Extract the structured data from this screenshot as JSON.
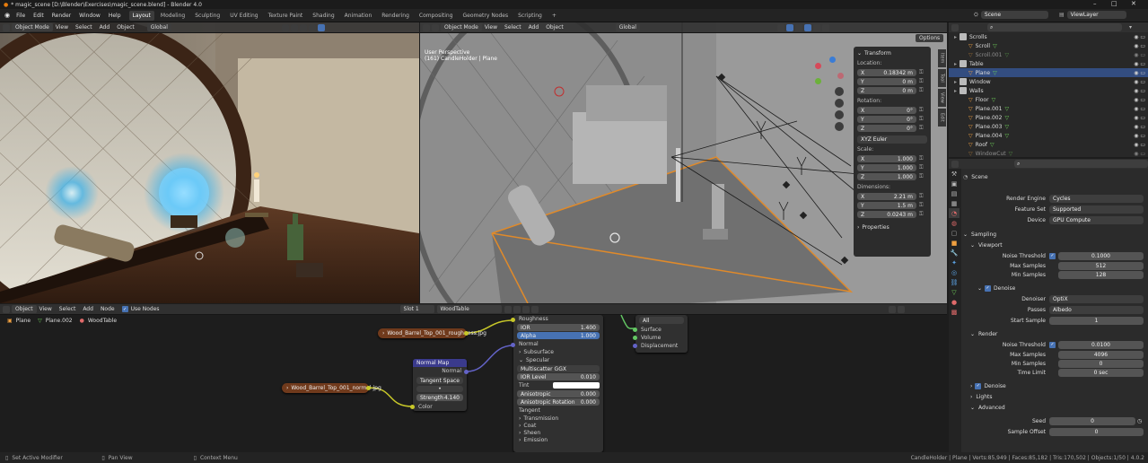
{
  "window": {
    "title": "* magic_scene [D:\\Blender\\Exercises\\magic_scene.blend] - Blender 4.0",
    "min": "–",
    "max": "□",
    "close": "✕"
  },
  "menu": [
    "File",
    "Edit",
    "Render",
    "Window",
    "Help"
  ],
  "workspaces": [
    "Layout",
    "Modeling",
    "Sculpting",
    "UV Editing",
    "Texture Paint",
    "Shading",
    "Animation",
    "Rendering",
    "Compositing",
    "Geometry Nodes",
    "Scripting"
  ],
  "active_workspace": "Layout",
  "add_workspace": "+",
  "scene": "Scene",
  "view_layer": "ViewLayer",
  "vp1": {
    "mode": "Object Mode",
    "menus": [
      "View",
      "Select",
      "Add",
      "Object"
    ],
    "orientation": "Global"
  },
  "vp2": {
    "mode": "Object Mode",
    "menus": [
      "View",
      "Select",
      "Add",
      "Object"
    ],
    "orientation": "Global",
    "options": "Options",
    "overlay_line1": "User Perspective",
    "overlay_line2": "(161) CandleHolder | Plane",
    "tabs": [
      "Item",
      "Tool",
      "View",
      "Edit"
    ],
    "transform": {
      "title": "Transform",
      "location_label": "Location:",
      "location": [
        {
          "axis": "X",
          "value": "0.18342 m"
        },
        {
          "axis": "Y",
          "value": "0 m"
        },
        {
          "axis": "Z",
          "value": "0 m"
        }
      ],
      "rotation_label": "Rotation:",
      "rotation": [
        {
          "axis": "X",
          "value": "0°"
        },
        {
          "axis": "Y",
          "value": "0°"
        },
        {
          "axis": "Z",
          "value": "0°"
        }
      ],
      "rotation_mode": "XYZ Euler",
      "scale_label": "Scale:",
      "scale": [
        {
          "axis": "X",
          "value": "1.000"
        },
        {
          "axis": "Y",
          "value": "1.000"
        },
        {
          "axis": "Z",
          "value": "1.000"
        }
      ],
      "dimensions_label": "Dimensions:",
      "dimensions": [
        {
          "axis": "X",
          "value": "2.21 m"
        },
        {
          "axis": "Y",
          "value": "1.5 m"
        },
        {
          "axis": "Z",
          "value": "0.0243 m"
        }
      ],
      "properties": "Properties"
    }
  },
  "node_editor": {
    "editor_type": "Object",
    "menus": [
      "View",
      "Select",
      "Add",
      "Node"
    ],
    "use_nodes": "Use Nodes",
    "slot": "Slot 1",
    "material": "WoodTable",
    "breadcrumb": [
      "Plane",
      "Plane.002",
      "WoodTable"
    ],
    "img_roughness": "Wood_Barrel_Top_001_roughness.jpg",
    "img_normal": "Wood_Barrel_Top_001_normal.jpg",
    "normal_map": {
      "title": "Normal Map",
      "output": "Normal",
      "space": "Tangent Space",
      "strength_label": "Strength",
      "strength": "4.140",
      "color": "Color"
    },
    "bsdf": {
      "roughness": "Roughness",
      "ior_label": "IOR",
      "ior": "1.400",
      "alpha_label": "Alpha",
      "alpha": "1.000",
      "normal": "Normal",
      "subsurface": "Subsurface",
      "specular": "Specular",
      "distribution": "Multiscatter GGX",
      "ior_level_label": "IOR Level",
      "ior_level": "0.010",
      "tint": "Tint",
      "anisotropic_label": "Anisotropic",
      "anisotropic": "0.000",
      "aniso_rot_label": "Anisotropic Rotation",
      "aniso_rot": "0.000",
      "tangent": "Tangent",
      "transmission": "Transmission",
      "coat": "Coat",
      "sheen": "Sheen",
      "emission": "Emission"
    },
    "output": {
      "target": "All",
      "surface": "Surface",
      "volume": "Volume",
      "displacement": "Displacement"
    }
  },
  "outliner": {
    "search_placeholder": "",
    "rows": [
      {
        "label": "Scrolls",
        "kind": "col",
        "depth": 0,
        "sel": false
      },
      {
        "label": "Scroll",
        "kind": "obj",
        "depth": 1,
        "sel": false
      },
      {
        "label": "Scroll.001",
        "kind": "obj",
        "depth": 1,
        "sel": false,
        "dim": true
      },
      {
        "label": "Table",
        "kind": "col",
        "depth": 0,
        "sel": false
      },
      {
        "label": "Plane",
        "kind": "obj",
        "depth": 1,
        "sel": true
      },
      {
        "label": "Window",
        "kind": "col",
        "depth": 0,
        "sel": false
      },
      {
        "label": "Walls",
        "kind": "col",
        "depth": 0,
        "sel": false
      },
      {
        "label": "Floor",
        "kind": "obj",
        "depth": 1,
        "sel": false
      },
      {
        "label": "Plane.001",
        "kind": "obj",
        "depth": 1,
        "sel": false
      },
      {
        "label": "Plane.002",
        "kind": "obj",
        "depth": 1,
        "sel": false
      },
      {
        "label": "Plane.003",
        "kind": "obj",
        "depth": 1,
        "sel": false
      },
      {
        "label": "Plane.004",
        "kind": "obj",
        "depth": 1,
        "sel": false
      },
      {
        "label": "Roof",
        "kind": "obj",
        "depth": 1,
        "sel": false
      },
      {
        "label": "WindowCut",
        "kind": "obj",
        "depth": 1,
        "sel": false,
        "dim": true
      }
    ]
  },
  "properties": {
    "context": "Scene",
    "render_engine_label": "Render Engine",
    "render_engine": "Cycles",
    "feature_set_label": "Feature Set",
    "feature_set": "Supported",
    "device_label": "Device",
    "device": "GPU Compute",
    "sampling": "Sampling",
    "viewport": "Viewport",
    "noise_threshold_label": "Noise Threshold",
    "vp_noise": "0.1000",
    "max_samples_label": "Max Samples",
    "vp_max": "512",
    "min_samples_label": "Min Samples",
    "vp_min": "128",
    "denoise": "Denoise",
    "denoiser_label": "Denoiser",
    "denoiser": "OptiX",
    "passes_label": "Passes",
    "passes": "Albedo",
    "start_sample_label": "Start Sample",
    "start_sample": "1",
    "render": "Render",
    "r_noise": "0.0100",
    "r_max": "4096",
    "r_min": "0",
    "time_limit_label": "Time Limit",
    "time_limit": "0 sec",
    "denoise2": "Denoise",
    "lights": "Lights",
    "advanced": "Advanced",
    "seed_label": "Seed",
    "seed": "0",
    "sample_offset_label": "Sample Offset",
    "sample_offset": "0"
  },
  "status": {
    "left": "Set Active Modifier",
    "mid": "Pan View",
    "ctx": "Context Menu",
    "right": "CandleHolder | Plane | Verts:85,949 | Faces:85,182 | Tris:170,502 | Objects:1/50 | 4.0.2"
  }
}
